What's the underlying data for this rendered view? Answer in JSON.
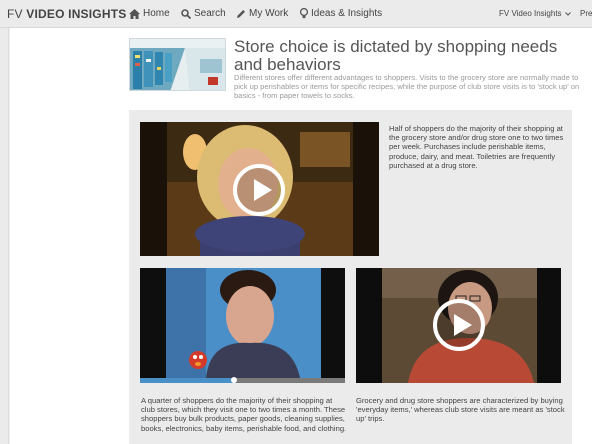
{
  "nav": {
    "logo_light": "FV ",
    "logo_bold": "VIDEO INSIGHTS",
    "home": "Home",
    "search": "Search",
    "my_work": "My Work",
    "ideas": "Ideas & Insights",
    "account": "FV Video Insights",
    "cutoff": "Pre"
  },
  "article": {
    "title": "Store choice is dictated by shopping needs and behaviors",
    "subtitle": "Different stores offer different advantages to shoppers. Visits to the grocery store are normally made to pick up perishables or items for specific recipes, while the purpose of club store visits is to 'stock up' on basics - from paper towels to socks."
  },
  "videos": [
    {
      "caption": "Half of shoppers do the majority of their shopping at the grocery store and/or drug store one to two times per week. Purchases include perishable items, produce, dairy, and meat. Toiletries are frequently purchased at a drug store."
    },
    {
      "caption": "A quarter of shoppers do the majority of their shopping at club stores, which they visit one to two times a month. These shoppers buy bulk products, paper goods, cleaning supplies, books, electronics, baby items, perishable food, and clothing.",
      "progress": 0.46
    },
    {
      "caption": "Grocery and drug store shoppers are characterized by buying 'everyday items,' whereas club store visits are meant as 'stock up' trips."
    }
  ]
}
